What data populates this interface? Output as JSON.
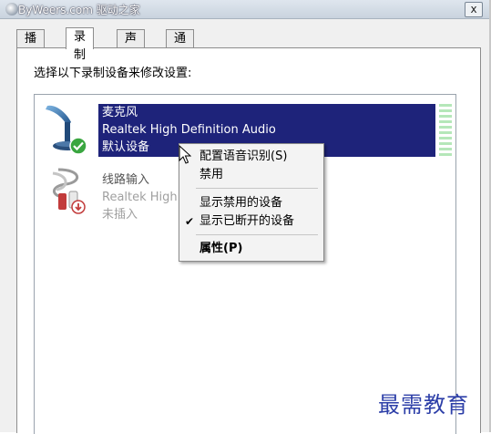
{
  "window": {
    "title": "ByWeers.com 驱动之家",
    "close_label": "x"
  },
  "tabs": [
    {
      "label": "播放",
      "active": false
    },
    {
      "label": "录制",
      "active": true
    },
    {
      "label": "声音",
      "active": false
    },
    {
      "label": "通信",
      "active": false
    }
  ],
  "instruction": "选择以下录制设备来修改设置:",
  "devices": [
    {
      "name": "麦克风",
      "driver": "Realtek High Definition Audio",
      "status": "默认设备",
      "icon": "microphone-icon",
      "badge": "default-check-icon"
    },
    {
      "name": "线路输入",
      "driver": "Realtek High",
      "status": "未插入",
      "icon": "line-in-cable-icon",
      "badge": "unplugged-arrow-icon"
    }
  ],
  "context_menu": {
    "items": [
      {
        "label": "配置语音识别(S)"
      },
      {
        "label": "禁用"
      },
      {
        "label": "显示禁用的设备"
      },
      {
        "label": "显示已断开的设备",
        "checked": true
      },
      {
        "label": "属性(P)",
        "bold": true
      }
    ]
  },
  "watermark": "最需教育",
  "colors": {
    "selection": "#1e237a",
    "level_meter": "#b5e7b9",
    "watermark": "#2d3fa8"
  }
}
